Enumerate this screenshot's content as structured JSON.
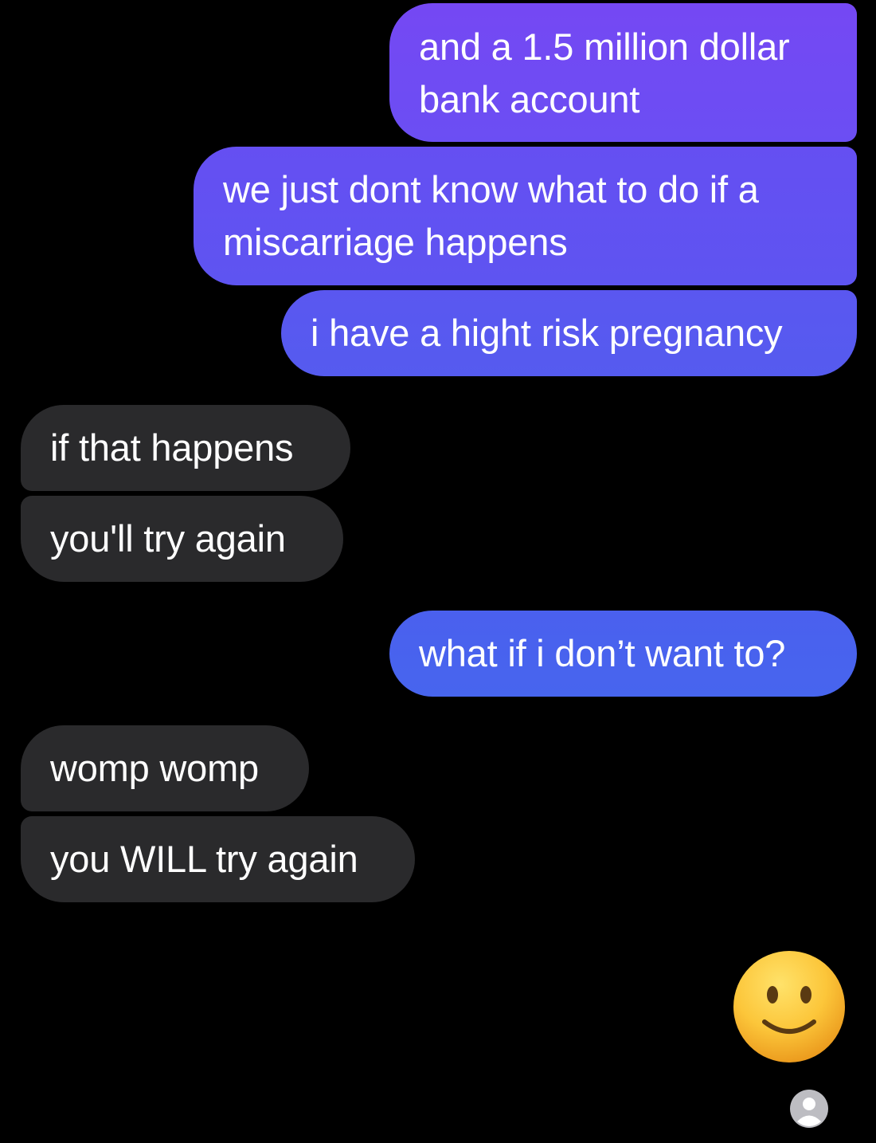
{
  "conversation": {
    "messages": [
      {
        "sender": "me",
        "text": "and a 1.5 million dollar\nbank account"
      },
      {
        "sender": "me",
        "text": "we just dont know what to do if a\nmiscarriage happens"
      },
      {
        "sender": "me",
        "text": "i have a hight risk pregnancy"
      },
      {
        "sender": "them",
        "text": "if that happens"
      },
      {
        "sender": "them",
        "text": "you'll try again"
      },
      {
        "sender": "me",
        "text": "what if i don’t want to?"
      },
      {
        "sender": "them",
        "text": "womp womp"
      },
      {
        "sender": "them",
        "text": "you WILL try again"
      }
    ],
    "reaction": {
      "icon": "slightly-smiling-face-emoji"
    },
    "seen_indicator": {
      "icon": "default-avatar-icon"
    }
  },
  "colors": {
    "background": "#000000",
    "sent_gradient_top": "#7548f3",
    "sent_gradient_bottom": "#4765ee",
    "received_bubble": "#2a2a2c",
    "text": "#ffffff"
  }
}
